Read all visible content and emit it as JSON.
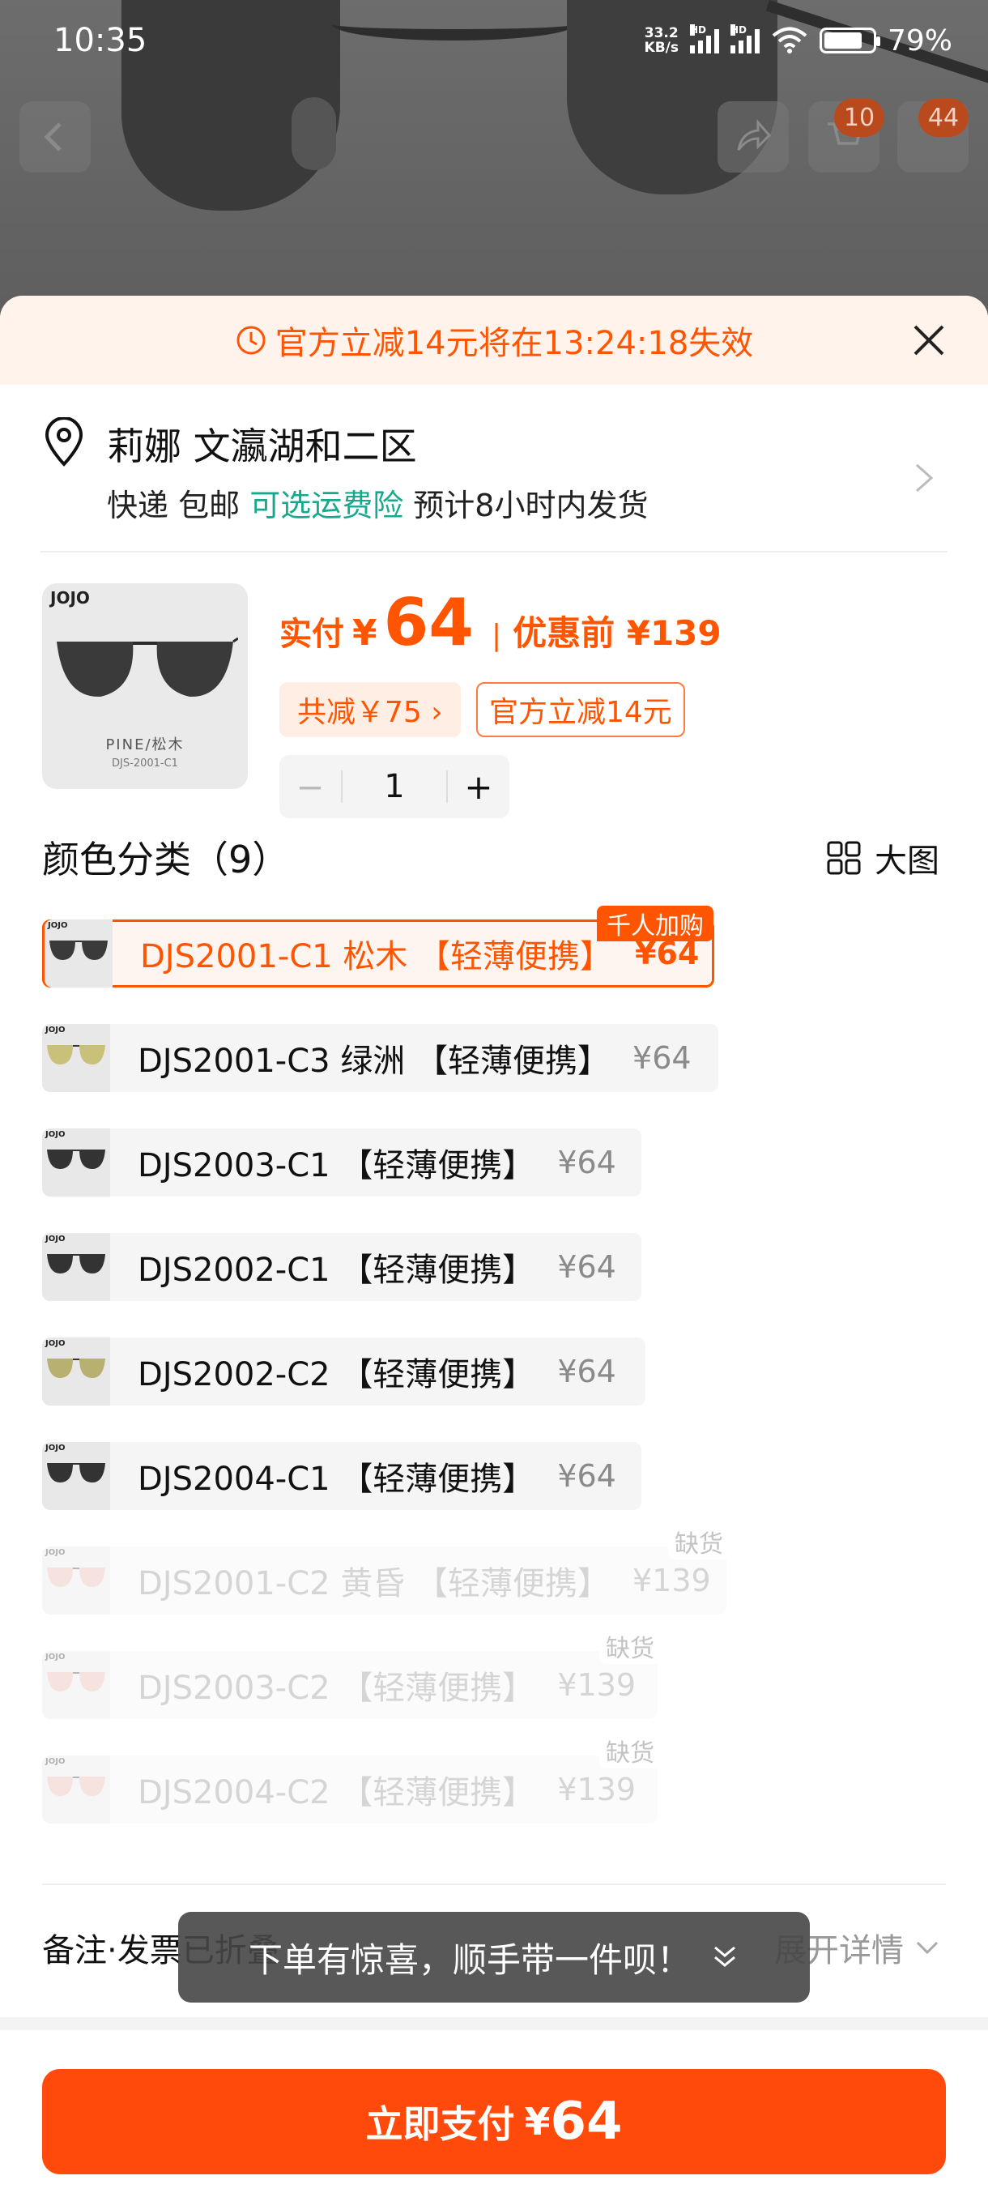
{
  "status_bar": {
    "time": "10:35",
    "net_speed_top": "33.2",
    "net_speed_bottom": "KB/s",
    "signal_label": "HD",
    "battery": "79%",
    "battery_level": 0.79
  },
  "header": {
    "cart_badge_1": "10",
    "cart_badge_2": "44"
  },
  "promo": {
    "text": "官方立减14元将在13:24:18失效"
  },
  "address": {
    "name": "莉娜 文瀛湖和二区",
    "ship_prefix": "快递 包邮",
    "insurance": "可选运费险",
    "ship_suffix": "预计8小时内发货"
  },
  "product": {
    "brand": "JOJO",
    "caption": "PINE/松木",
    "model": "DJS-2001-C1",
    "pay_label": "实付",
    "currency": "¥",
    "price": "64",
    "separator": "|",
    "orig_price": "优惠前 ¥139",
    "save_chip": "共减￥75 ›",
    "off_chip": "官方立减14元",
    "qty_minus": "−",
    "qty": "1",
    "qty_plus": "+"
  },
  "variants_section": {
    "title": "颜色分类（9）",
    "big_view": "大图"
  },
  "variants": [
    {
      "label": "DJS2001-C1 松木 【轻薄便携】",
      "price": "¥64",
      "tag": "千人加购",
      "state": "selected",
      "lens": "#3a3a3a"
    },
    {
      "label": "DJS2001-C3 绿洲 【轻薄便携】",
      "price": "¥64",
      "state": "normal",
      "lens": "#c9c07a"
    },
    {
      "label": "DJS2003-C1 【轻薄便携】",
      "price": "¥64",
      "state": "normal",
      "lens": "#333333"
    },
    {
      "label": "DJS2002-C1 【轻薄便携】",
      "price": "¥64",
      "state": "normal",
      "lens": "#333333"
    },
    {
      "label": "DJS2002-C2 【轻薄便携】",
      "price": "¥64",
      "state": "normal",
      "lens": "#b8b070"
    },
    {
      "label": "DJS2004-C1 【轻薄便携】",
      "price": "¥64",
      "state": "normal",
      "lens": "#333333"
    },
    {
      "label": "DJS2001-C2 黄昏 【轻薄便携】",
      "price": "¥139",
      "tag": "缺货",
      "state": "disabled",
      "lens": "#e6b0a8"
    },
    {
      "label": "DJS2003-C2 【轻薄便携】",
      "price": "¥139",
      "tag": "缺货",
      "state": "disabled",
      "lens": "#e6b0a8"
    },
    {
      "label": "DJS2004-C2 【轻薄便携】",
      "price": "¥139",
      "tag": "缺货",
      "state": "disabled",
      "lens": "#e6b0a8"
    }
  ],
  "footer": {
    "remark": "备注·发票已折叠",
    "expand": "展开详情",
    "toast": "下单有惊喜，顺手带一件呗！",
    "pay_label": "立即支付",
    "pay_currency": "¥",
    "pay_amount": "64"
  },
  "colors": {
    "accent": "#ff5500",
    "pay_button": "#ff4a0c",
    "insurance_green": "#18a98c"
  }
}
